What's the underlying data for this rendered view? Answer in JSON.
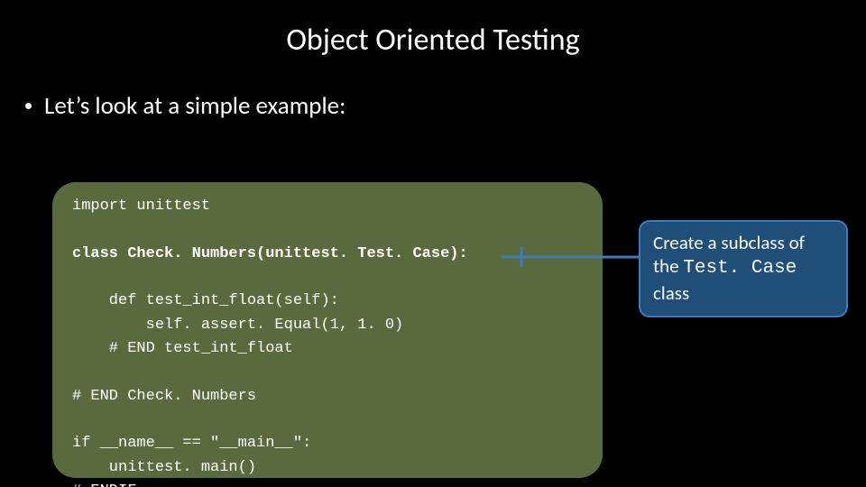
{
  "title": "Object Oriented Testing",
  "bullet": "Let’s look at a simple example:",
  "code": {
    "l1": "import unittest",
    "l2": "class Check. Numbers(unittest. Test. Case):",
    "l3": "    def test_int_float(self):",
    "l4": "        self. assert. Equal(1, 1. 0)",
    "l5": "    # END test_int_float",
    "l6": "# END Check. Numbers",
    "l7": "if __name__ == \"__main__\":",
    "l8": "    unittest. main()",
    "l9": "# ENDIF"
  },
  "callout": {
    "pre": "Create a subclass of the ",
    "mono": "Test. Case",
    "post": " class"
  },
  "colors": {
    "bg": "#000000",
    "code_bg": "#596b3d",
    "callout_bg": "#1f4e79",
    "callout_border": "#3a7cbf"
  }
}
